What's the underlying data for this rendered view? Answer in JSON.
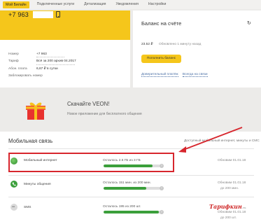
{
  "nav": {
    "tabs": [
      "Мой Билайн",
      "Подключенные услуги",
      "Детализация",
      "Уведомления",
      "Настройки"
    ]
  },
  "account": {
    "phone": "+7 963",
    "rows": [
      {
        "label": "Номер",
        "value": "+7 963"
      },
      {
        "label": "Тариф",
        "value": "Всё за 200 архив 04.2017"
      },
      {
        "label": "Абон. плата",
        "value": "6,67 ₽ в сутки"
      }
    ],
    "block_link": "Заблокировать номер"
  },
  "balance": {
    "title": "Баланс на счёте",
    "amount": "23.52 ₽",
    "updated": "Обновлено 1 минуту назад",
    "pay_button": "Пополнить баланс",
    "links": [
      "Доверительный платёж",
      "Всегда на связи"
    ]
  },
  "promo": {
    "title": "Скачайте VEON!",
    "subtitle": "Новое приложение для бесплатного общения"
  },
  "mobile": {
    "title": "Мобильная связь",
    "note": "Доступный мобильный интернет, минуты и СМС",
    "services": [
      {
        "name": "Мобильный интернет",
        "left": "Осталось 2.6 ГБ из 3 ГБ",
        "fraction": 0.87,
        "updated": "Обновим 01.01.18",
        "updated2": ""
      },
      {
        "name": "Минуты общения",
        "left": "Осталось 151 мин. из 200 мин.",
        "fraction": 0.755,
        "updated": "Обновим 01.01.18",
        "updated2": "до 200 мин."
      },
      {
        "name": "SMS",
        "left": "Осталось 195 из 200 шт.",
        "fraction": 0.975,
        "updated": "Обновим 01.01.18",
        "updated2": "до 200 шт."
      }
    ]
  },
  "watermark": {
    "brand": "Тарифкин",
    "suffix": ".ru"
  },
  "colors": {
    "accent": "#f5c61b",
    "progress": "#3b9f3b",
    "highlight": "#d7262d"
  }
}
